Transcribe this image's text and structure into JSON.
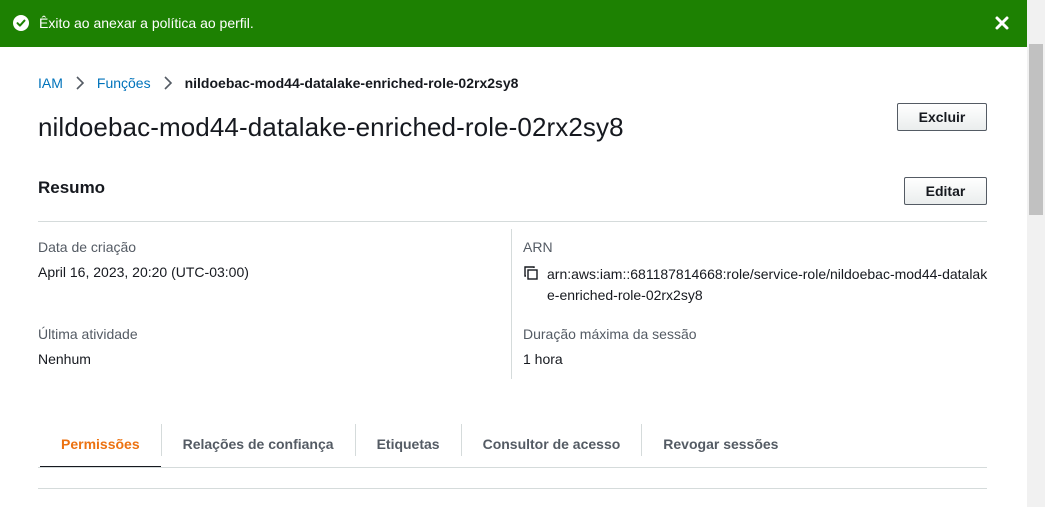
{
  "flash": {
    "message": "Êxito ao anexar a política ao perfil.",
    "color": "#1d8102",
    "icon": "check-circle-icon",
    "close_icon": "close-icon"
  },
  "breadcrumb": {
    "items": [
      "IAM",
      "Funções"
    ],
    "current": "nildoebac-mod44-datalake-enriched-role-02rx2sy8",
    "separator_icon": "chevron-right-icon"
  },
  "page": {
    "title": "nildoebac-mod44-datalake-enriched-role-02rx2sy8",
    "delete_label": "Excluir"
  },
  "summary": {
    "title": "Resumo",
    "edit_label": "Editar",
    "creation_label": "Data de criação",
    "creation_value": "April 16, 2023, 20:20 (UTC-03:00)",
    "arn_label": "ARN",
    "arn_value": "arn:aws:iam::681187814668:role/service-role/nildoebac-mod44-datalake-enriched-role-02rx2sy8",
    "copy_icon": "copy-icon",
    "last_activity_label": "Última atividade",
    "last_activity_value": "Nenhum",
    "max_session_label": "Duração máxima da sessão",
    "max_session_value": "1 hora"
  },
  "tabs": {
    "items": [
      "Permissões",
      "Relações de confiança",
      "Etiquetas",
      "Consultor de acesso",
      "Revogar sessões"
    ],
    "active": "Permissões",
    "active_color": "#ec7211"
  }
}
